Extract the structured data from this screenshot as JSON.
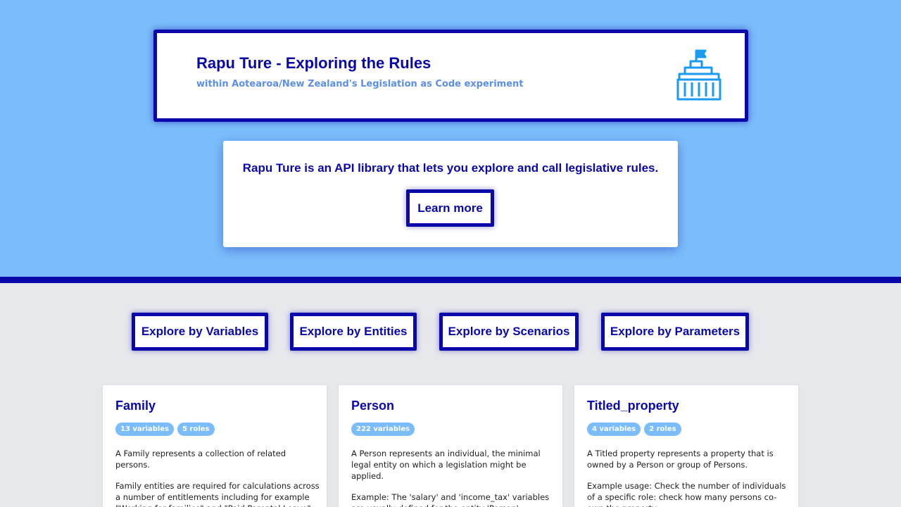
{
  "header": {
    "title": "Rapu Ture - Exploring the Rules",
    "subtitle": "within Aotearoa/New Zealand's Legislation as Code experiment",
    "icon": "parliament-building-icon"
  },
  "intro": {
    "text": "Rapu Ture is an API library that lets you explore and call legislative rules.",
    "learn_more_label": "Learn more"
  },
  "nav": {
    "variables": "Explore by Variables",
    "entities": "Explore by Entities",
    "scenarios": "Explore by Scenarios",
    "parameters": "Explore by Parameters"
  },
  "entities": [
    {
      "name": "Family",
      "badges": [
        "13 variables",
        "5 roles"
      ],
      "description": [
        "A Family represents a collection of related persons.",
        "Family entities are required for calculations across a number of entitlements including for example \"Working for families\" and \"Paid Parental Leave\""
      ]
    },
    {
      "name": "Person",
      "badges": [
        "222 variables"
      ],
      "description": [
        "A Person represents an individual, the minimal legal entity on which a legislation might be applied.",
        "Example: The 'salary' and 'income_tax' variables are usually defined for the entity 'Person'."
      ]
    },
    {
      "name": "Titled_property",
      "badges": [
        "4 variables",
        "2 roles"
      ],
      "description": [
        "A Titled property represents a property that is owned by a Person or group of Persons.",
        "Example usage: Check the number of individuals of a specific role: check how many persons co-own the property."
      ]
    }
  ],
  "colors": {
    "hero_bg": "#7abdfa",
    "primary": "#0a08a8",
    "page_bg": "#e6e8ec",
    "subtitle": "#5b8fe8",
    "badge_bg": "#7abdfa",
    "icon": "#1a9bf0"
  }
}
